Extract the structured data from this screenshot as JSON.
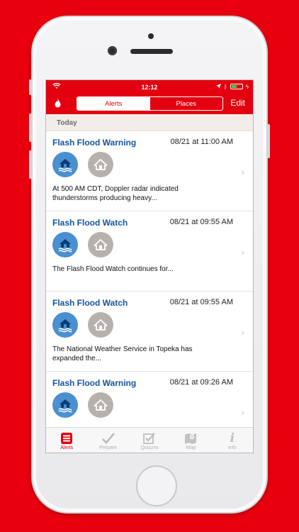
{
  "status": {
    "time": "12:12"
  },
  "nav": {
    "segments": [
      "Alerts",
      "Places"
    ],
    "edit_label": "Edit"
  },
  "section": {
    "label": "Today"
  },
  "alerts": [
    {
      "title": "Flash Flood Warning",
      "date": "08/21 at 11:00 AM",
      "desc": "At 500 AM CDT, Doppler radar indicated thunderstorms producing heavy..."
    },
    {
      "title": "Flash Flood Watch",
      "date": "08/21 at 09:55 AM",
      "desc": "The Flash Flood Watch continues for..."
    },
    {
      "title": "Flash Flood Watch",
      "date": "08/21 at 09:55 AM",
      "desc": "The National Weather Service in Topeka has expanded the..."
    },
    {
      "title": "Flash Flood Warning",
      "date": "08/21 at 09:26 AM",
      "desc": ""
    }
  ],
  "tabs": [
    {
      "label": "Alerts",
      "icon": "list-icon",
      "active": true
    },
    {
      "label": "Prepare",
      "icon": "checkmark-icon",
      "active": false
    },
    {
      "label": "Quizzes",
      "icon": "checkbox-icon",
      "active": false
    },
    {
      "label": "Map",
      "icon": "map-icon",
      "active": false
    },
    {
      "label": "Info",
      "icon": "info-icon",
      "active": false
    }
  ],
  "colors": {
    "brand_red": "#e3000f",
    "title_blue": "#12549e",
    "flood_icon_blue": "#4a8fd0",
    "home_icon_gray": "#b7b1ac"
  }
}
